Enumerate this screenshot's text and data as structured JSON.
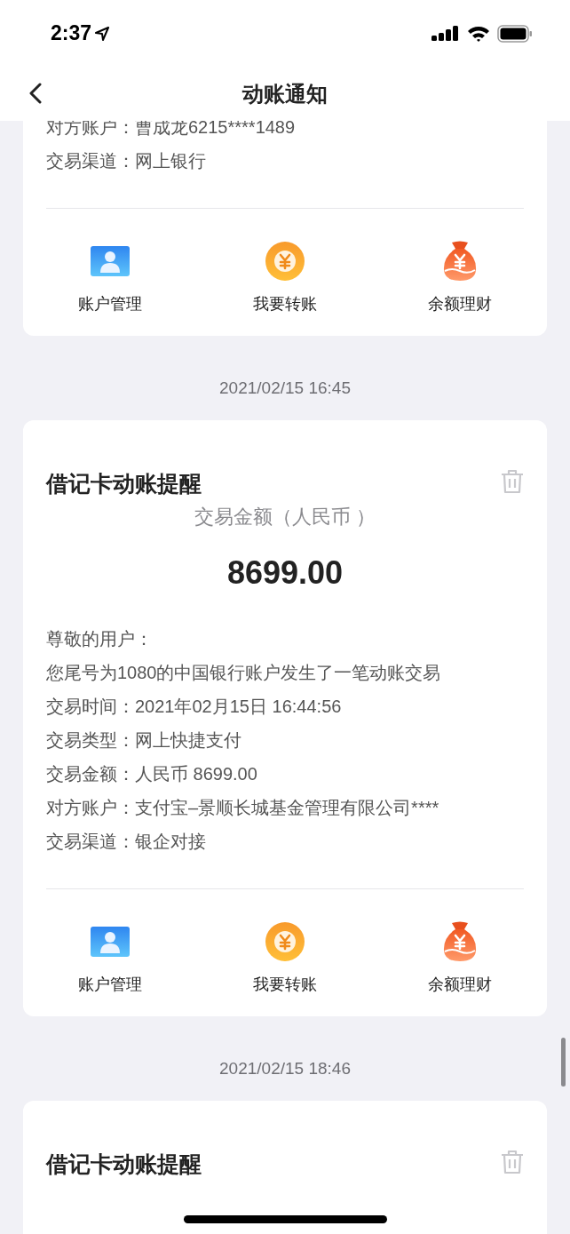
{
  "status_bar": {
    "time": "2:37"
  },
  "nav": {
    "title": "动账通知"
  },
  "feed": [
    {
      "kind": "card",
      "lines": [
        {
          "label": "对方账户：",
          "value": "曹成龙6215****1489"
        },
        {
          "label": "交易渠道：",
          "value": "网上银行"
        }
      ],
      "actions": [
        {
          "kind": "account",
          "label": "账户管理"
        },
        {
          "kind": "transfer",
          "label": "我要转账"
        },
        {
          "kind": "wealth",
          "label": "余额理财"
        }
      ]
    },
    {
      "kind": "time",
      "text": "2021/02/15 16:45"
    },
    {
      "kind": "card",
      "title": "借记卡动账提醒",
      "amount_label": "交易金额（人民币 ）",
      "amount": "8699.00",
      "greeting": "尊敬的用户：",
      "message": "您尾号为1080的中国银行账户发生了一笔动账交易",
      "lines": [
        {
          "label": "交易时间：",
          "value": "2021年02月15日 16:44:56"
        },
        {
          "label": "交易类型：",
          "value": "网上快捷支付"
        },
        {
          "label": "交易金额：",
          "value": "人民币 8699.00"
        },
        {
          "label": "对方账户：",
          "value": "支付宝–景顺长城基金管理有限公司****"
        },
        {
          "label": "交易渠道：",
          "value": "银企对接"
        }
      ],
      "actions": [
        {
          "kind": "account",
          "label": "账户管理"
        },
        {
          "kind": "transfer",
          "label": "我要转账"
        },
        {
          "kind": "wealth",
          "label": "余额理财"
        }
      ]
    },
    {
      "kind": "time",
      "text": "2021/02/15 18:46"
    },
    {
      "kind": "card",
      "title": "借记卡动账提醒"
    }
  ]
}
